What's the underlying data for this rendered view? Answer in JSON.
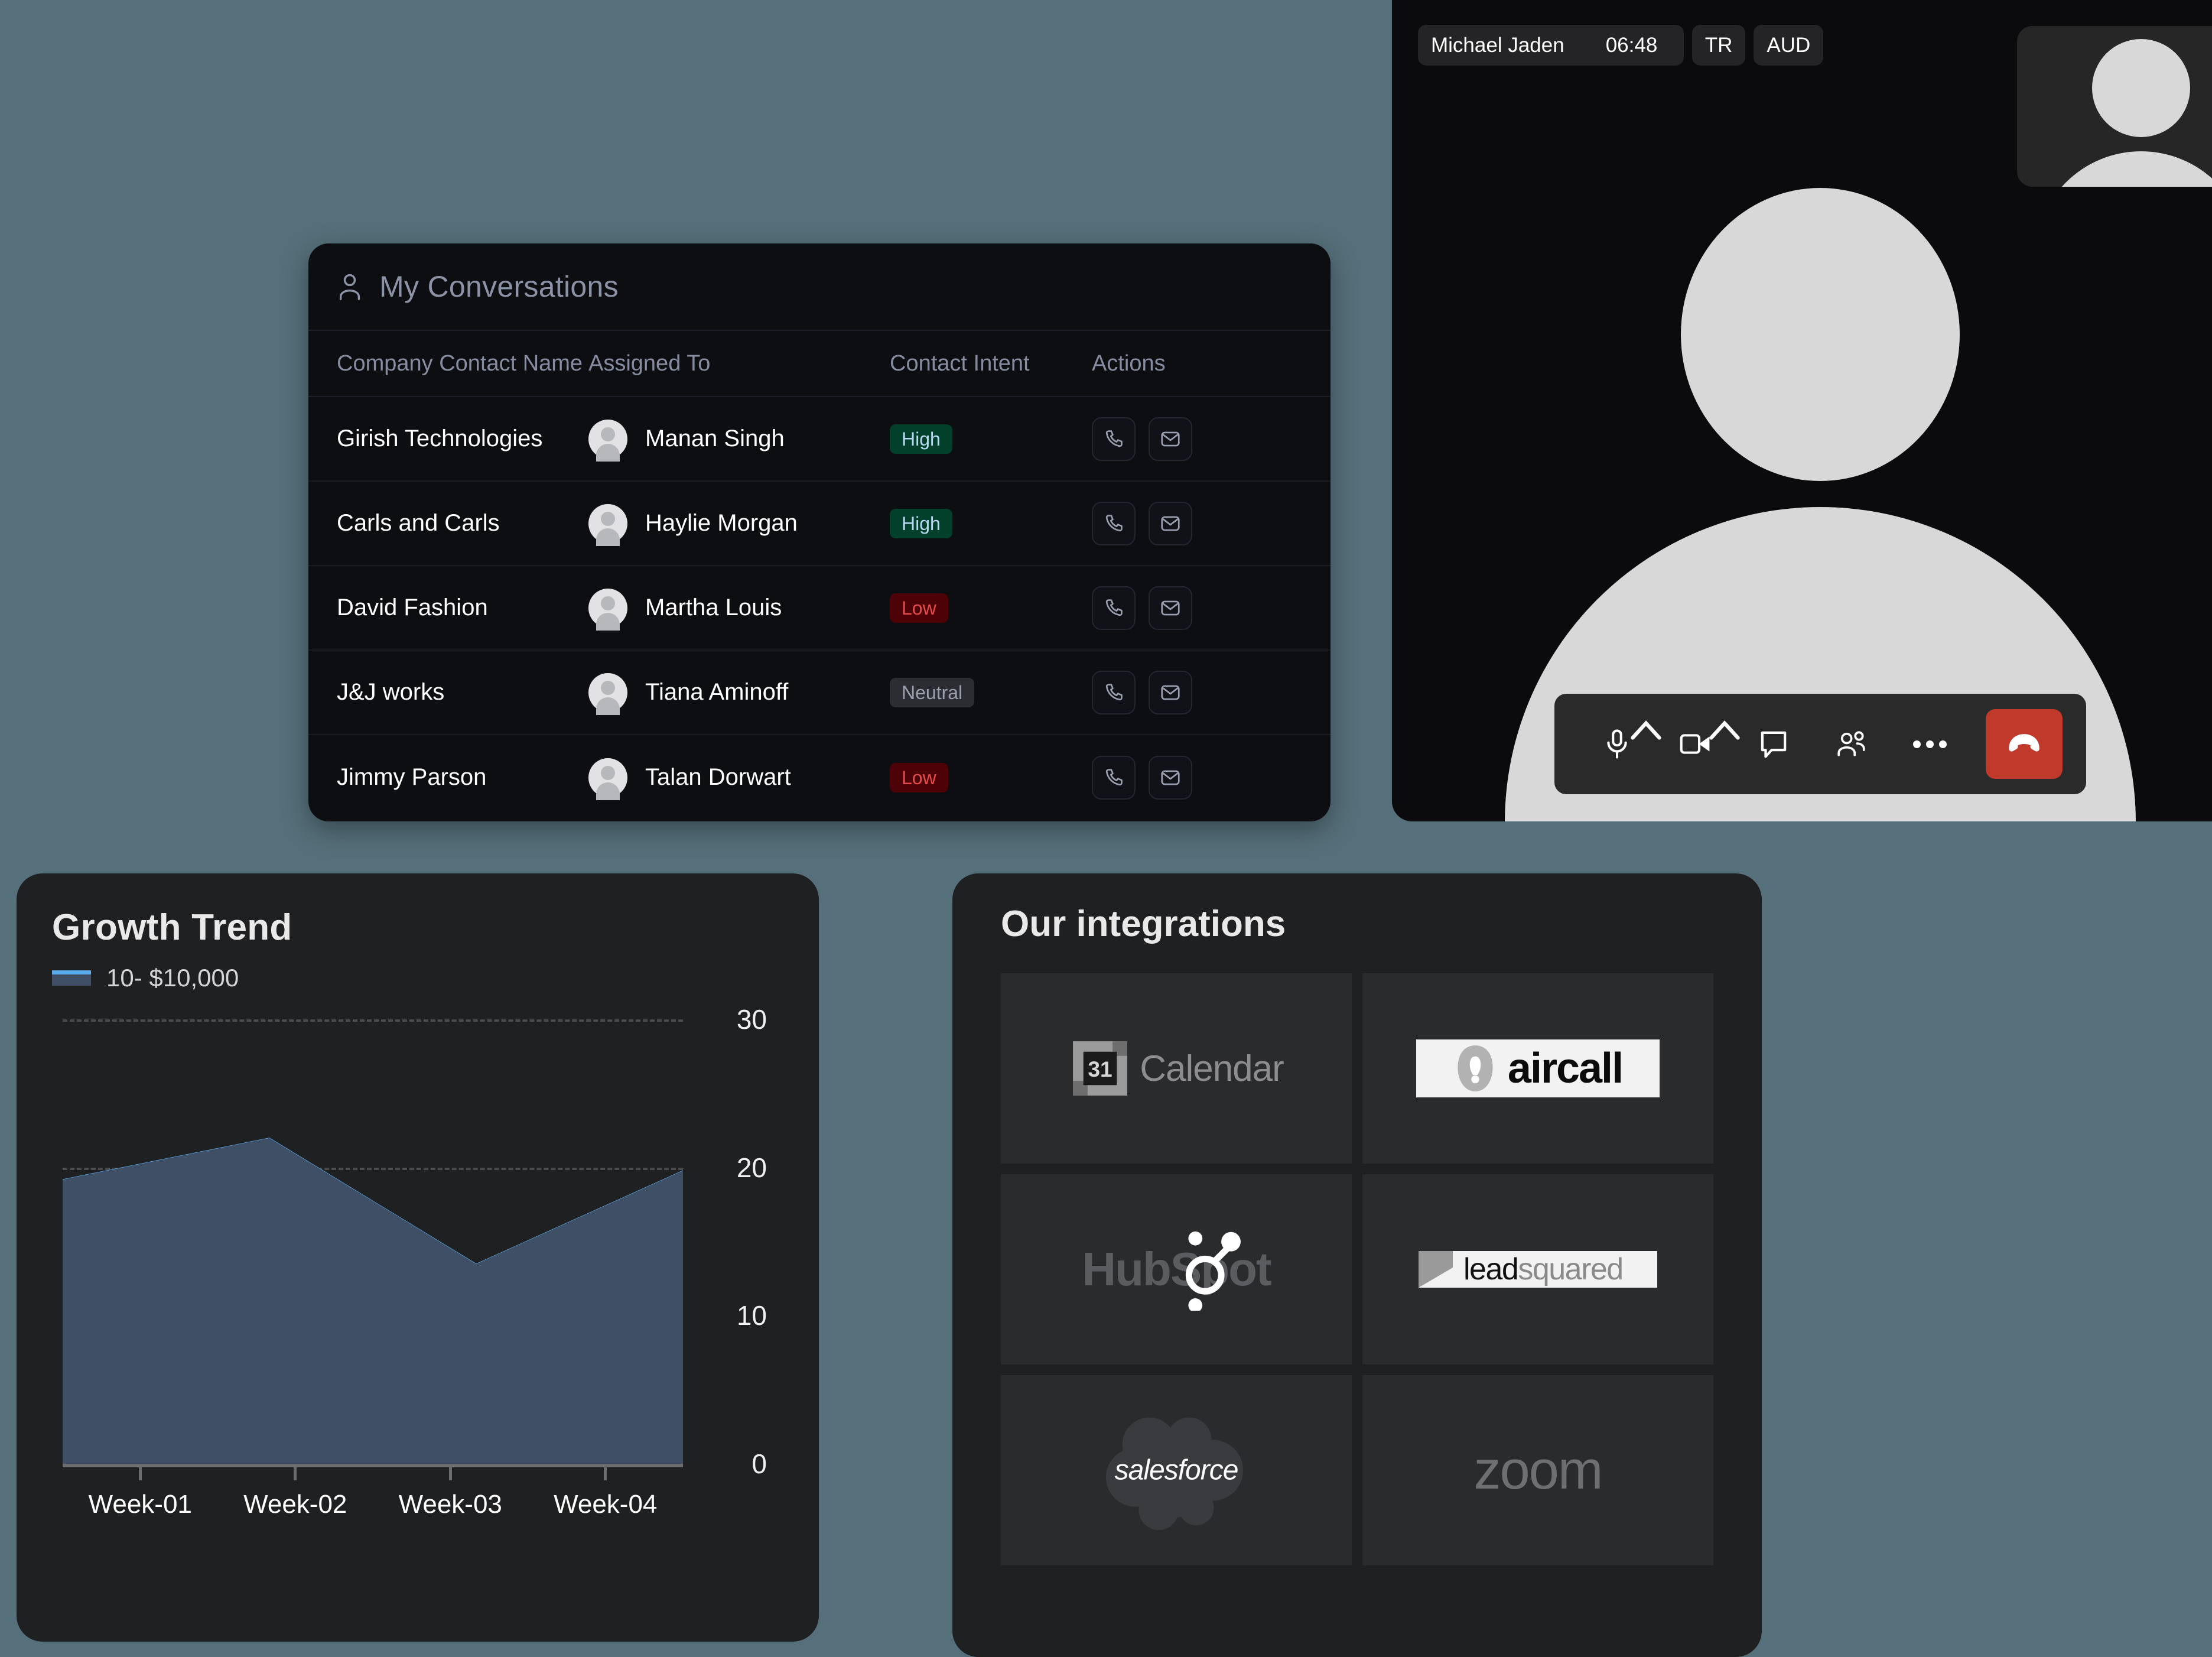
{
  "background_color": "#55707a",
  "conversations": {
    "title": "My Conversations",
    "title_icon": "person-icon",
    "columns": [
      "Company Contact Name",
      "Assigned To",
      "Contact Intent",
      "Actions"
    ],
    "rows": [
      {
        "company": "Girish Technologies",
        "assigned_to": "Manan Singh",
        "intent": "High",
        "intent_class": "high",
        "actions": [
          "phone-icon",
          "mail-icon"
        ]
      },
      {
        "company": "Carls and Carls",
        "assigned_to": "Haylie Morgan",
        "intent": "High",
        "intent_class": "high",
        "actions": [
          "phone-icon",
          "mail-icon"
        ]
      },
      {
        "company": "David Fashion",
        "assigned_to": "Martha Louis",
        "intent": "Low",
        "intent_class": "low",
        "actions": [
          "phone-icon",
          "mail-icon"
        ]
      },
      {
        "company": "J&J works",
        "assigned_to": "Tiana Aminoff",
        "intent": "Neutral",
        "intent_class": "neutral",
        "actions": [
          "phone-icon",
          "mail-icon"
        ]
      },
      {
        "company": "Jimmy Parson",
        "assigned_to": "Talan Dorwart",
        "intent": "Low",
        "intent_class": "low",
        "actions": [
          "phone-icon",
          "mail-icon"
        ]
      }
    ],
    "badge_colors": {
      "high_bg": "#02402c",
      "high_text": "#b9d9f2",
      "low_bg": "#4c0207",
      "low_text": "#e54b4b",
      "neutral_bg": "#2c2d33",
      "neutral_text": "#9aa0ae"
    }
  },
  "call": {
    "participant_name": "Michael Jaden",
    "timer": "06:48",
    "badges": [
      "TR",
      "AUD"
    ],
    "controls": [
      {
        "name": "microphone-icon",
        "has_caret": true
      },
      {
        "name": "camera-icon",
        "has_caret": true
      },
      {
        "name": "chat-icon",
        "has_caret": false
      },
      {
        "name": "participants-icon",
        "has_caret": false
      },
      {
        "name": "more-options-icon",
        "has_caret": false
      }
    ],
    "end_call_icon": "end-call-icon",
    "end_call_color": "#c0392b"
  },
  "chart_data": {
    "type": "area",
    "title": "Growth Trend",
    "legend": [
      {
        "label": "10- $10,000",
        "line_color": "#5aa9e6",
        "fill_color": "#3e4f66"
      }
    ],
    "categories": [
      "Week-01",
      "Week-02",
      "Week-03",
      "Week-04"
    ],
    "values": [
      19.2,
      22.0,
      13.5,
      19.8
    ],
    "ylim": [
      0,
      30
    ],
    "yticks": [
      0,
      10,
      20,
      30
    ],
    "ytick_labels": [
      "0",
      "10",
      "20",
      "30"
    ],
    "xlabel": "",
    "ylabel": "",
    "grid": true,
    "legend_position": "top-left"
  },
  "integrations": {
    "title": "Our integrations",
    "tiles": [
      {
        "name": "google-calendar",
        "label": "Calendar",
        "icon": "calendar-31-icon",
        "style": "dark"
      },
      {
        "name": "aircall",
        "label": "aircall",
        "icon": "aircall-logo-icon",
        "style": "white"
      },
      {
        "name": "hubspot",
        "label": "HubSpot",
        "icon": "hubspot-logo-icon",
        "style": "dark"
      },
      {
        "name": "leadsquared",
        "label_dark": "lead",
        "label_light": "squared",
        "icon": "leadsquared-logo-icon",
        "style": "white"
      },
      {
        "name": "salesforce",
        "label": "salesforce",
        "icon": "salesforce-cloud-icon",
        "style": "dark"
      },
      {
        "name": "zoom",
        "label": "zoom",
        "icon": "zoom-logo-icon",
        "style": "dark"
      }
    ]
  }
}
